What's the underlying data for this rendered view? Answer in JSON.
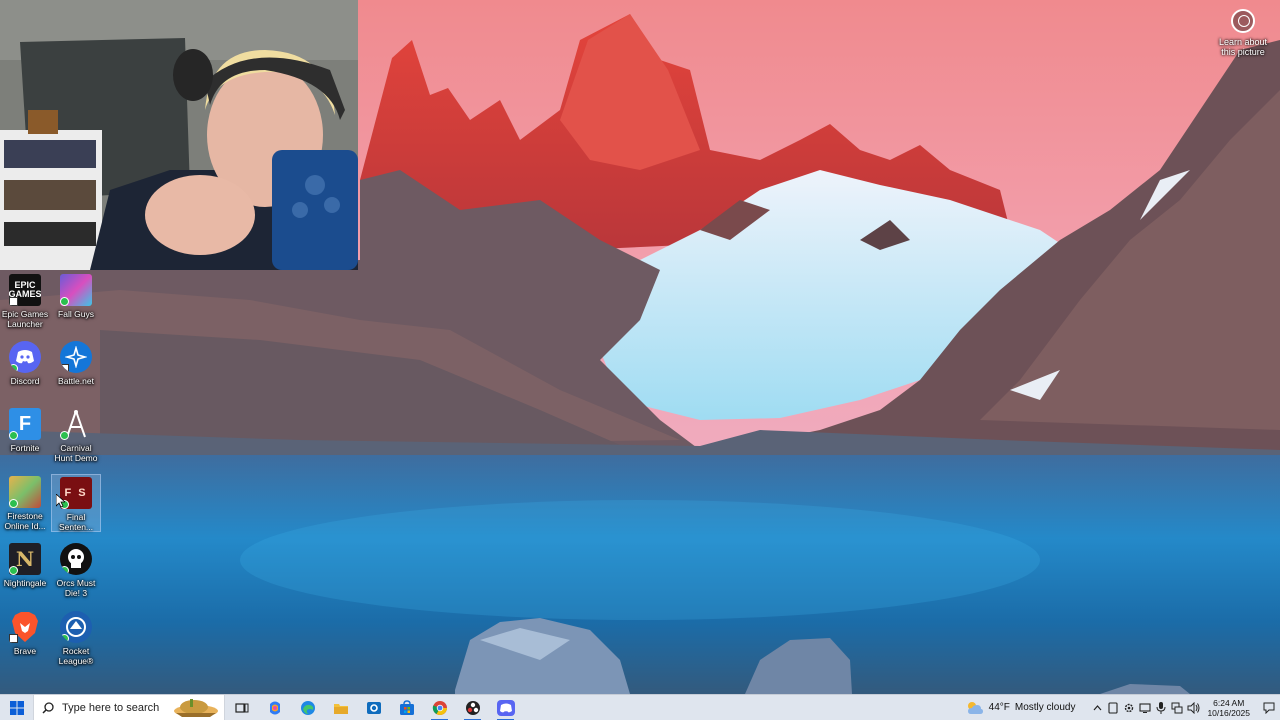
{
  "spotlight": {
    "label": "Learn about this picture"
  },
  "desktop_icons": [
    {
      "label": "Epic Games Launcher",
      "badge": "arrow"
    },
    {
      "label": "Fall Guys",
      "badge": "check"
    },
    {
      "label": "Discord",
      "badge": "check"
    },
    {
      "label": "Battle.net",
      "badge": "arrow"
    },
    {
      "label": "Fortnite",
      "badge": "check"
    },
    {
      "label": "Carnival Hunt Demo",
      "badge": "check"
    },
    {
      "label": "Firestone Online Id...",
      "badge": "check"
    },
    {
      "label": "Final Senten...",
      "badge": "check",
      "mark": "F S"
    },
    {
      "label": "Nightingale",
      "badge": "check"
    },
    {
      "label": "Orcs Must Die! 3",
      "badge": "check"
    },
    {
      "label": "Brave",
      "badge": "arrow"
    },
    {
      "label": "Rocket League®",
      "badge": "check"
    }
  ],
  "epic_mark": "EPIC\nGAMES",
  "taskbar": {
    "search_placeholder": "Type here to search",
    "apps": [
      "start-icon",
      "task-view-icon",
      "copilot-icon",
      "edge-icon",
      "file-explorer-icon",
      "outlook-icon",
      "microsoft-store-icon",
      "chrome-icon",
      "obs-icon",
      "discord-icon"
    ]
  },
  "tray": {
    "temperature": "44°F",
    "weather": "Mostly cloudy",
    "time": "6:24 AM",
    "date": "10/16/2025"
  }
}
